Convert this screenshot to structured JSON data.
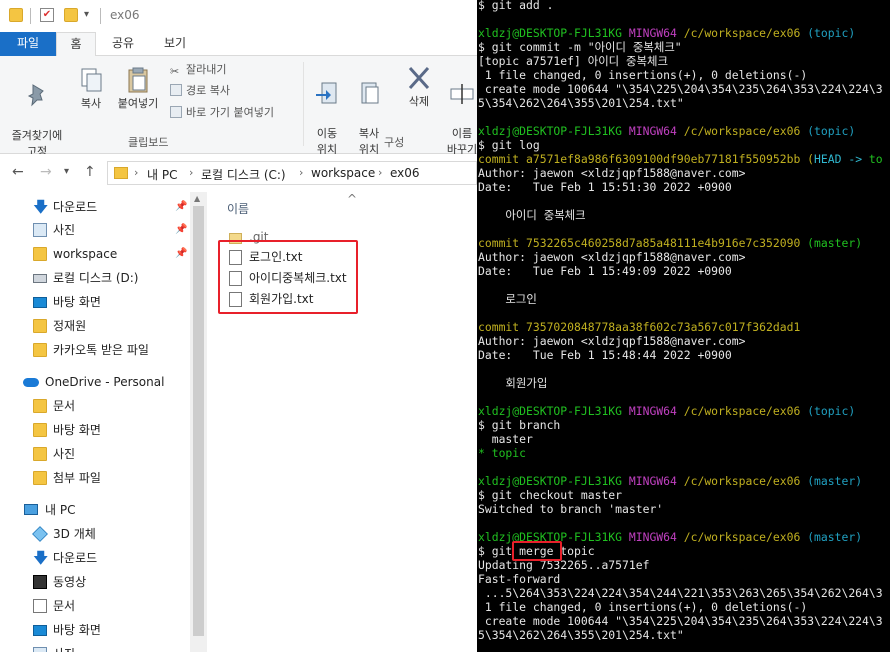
{
  "window": {
    "title": "ex06"
  },
  "ribbon": {
    "tabs": [
      "파일",
      "홈",
      "공유",
      "보기"
    ],
    "clipboard": {
      "pin_quick": "즐겨찾기에\n고정",
      "copy": "복사",
      "paste": "붙여넣기",
      "cut": "잘라내기",
      "copy_path": "경로 복사",
      "paste_shortcut": "바로 가기 붙여넣기",
      "group_label": "클립보드"
    },
    "organize": {
      "move_to": "이동\n위치",
      "copy_to": "복사\n위치",
      "delete": "삭제",
      "rename": "이름\n바꾸기",
      "group_label": "구성"
    }
  },
  "address": {
    "crumbs": [
      "내 PC",
      "로컬 디스크 (C:)",
      "workspace",
      "ex06"
    ]
  },
  "nav": {
    "items": [
      {
        "label": "다운로드",
        "icon": "download-icon",
        "pinned": true
      },
      {
        "label": "사진",
        "icon": "pictures-icon",
        "pinned": true
      },
      {
        "label": "workspace",
        "icon": "folder-icon",
        "pinned": true
      },
      {
        "label": "로컬 디스크 (D:)",
        "icon": "drive-icon",
        "pinned": false
      },
      {
        "label": "바탕 화면",
        "icon": "desktop-icon",
        "pinned": false
      },
      {
        "label": "정재원",
        "icon": "folder-icon",
        "pinned": false
      },
      {
        "label": "카카오톡 받은 파일",
        "icon": "folder-icon",
        "pinned": false
      },
      {
        "label": "OneDrive - Personal",
        "icon": "onedrive-icon",
        "pinned": false
      },
      {
        "label": "문서",
        "icon": "folder-icon",
        "pinned": false
      },
      {
        "label": "바탕 화면",
        "icon": "folder-icon",
        "pinned": false
      },
      {
        "label": "사진",
        "icon": "folder-icon",
        "pinned": false
      },
      {
        "label": "첨부 파일",
        "icon": "folder-icon",
        "pinned": false
      },
      {
        "label": "내 PC",
        "icon": "pc-icon",
        "pinned": false
      },
      {
        "label": "3D 개체",
        "icon": "3d-objects-icon",
        "pinned": false
      },
      {
        "label": "다운로드",
        "icon": "download-icon",
        "pinned": false
      },
      {
        "label": "동영상",
        "icon": "videos-icon",
        "pinned": false
      },
      {
        "label": "문서",
        "icon": "documents-icon",
        "pinned": false
      },
      {
        "label": "바탕 화면",
        "icon": "desktop-icon",
        "pinned": false
      },
      {
        "label": "사진",
        "icon": "pictures-icon",
        "pinned": false
      }
    ]
  },
  "files": {
    "column_name": "이름",
    "items": [
      {
        "name": ".git",
        "type": "folder"
      },
      {
        "name": "로그인.txt",
        "type": "text"
      },
      {
        "name": "아이디중복체크.txt",
        "type": "text"
      },
      {
        "name": "회원가입.txt",
        "type": "text"
      }
    ]
  },
  "terminal": {
    "lines": [
      "$ git add .",
      "",
      "xldzj@DESKTOP-FJL31KG MINGW64 /c/workspace/ex06 (topic)",
      "$ git commit -m \"아이디 중복체크\"",
      "[topic a7571ef] 아이디 중복체크",
      " 1 file changed, 0 insertions(+), 0 deletions(-)",
      " create mode 100644 \"\\354\\225\\204\\354\\235\\264\\353\\224\\224\\3",
      "5\\354\\262\\264\\355\\201\\254.txt\"",
      "",
      "xldzj@DESKTOP-FJL31KG MINGW64 /c/workspace/ex06 (topic)",
      "$ git log",
      "commit a7571ef8a986f6309100df90eb77181f550952bb (HEAD -> to",
      "Author: jaewon <xldzjqpf1588@naver.com>",
      "Date:   Tue Feb 1 15:51:30 2022 +0900",
      "",
      "    아이디 중복체크",
      "",
      "commit 7532265c460258d7a85a48111e4b916e7c352090 (master)",
      "Author: jaewon <xldzjqpf1588@naver.com>",
      "Date:   Tue Feb 1 15:49:09 2022 +0900",
      "",
      "    로그인",
      "",
      "commit 7357020848778aa38f602c73a567c017f362dad1",
      "Author: jaewon <xldzjqpf1588@naver.com>",
      "Date:   Tue Feb 1 15:48:44 2022 +0900",
      "",
      "    회원가입",
      "",
      "xldzj@DESKTOP-FJL31KG MINGW64 /c/workspace/ex06 (topic)",
      "$ git branch",
      "  master",
      "* topic",
      "",
      "xldzj@DESKTOP-FJL31KG MINGW64 /c/workspace/ex06 (master)",
      "$ git checkout master",
      "Switched to branch 'master'",
      "",
      "xldzj@DESKTOP-FJL31KG MINGW64 /c/workspace/ex06 (master)",
      "$ git merge topic",
      "Updating 7532265..a7571ef",
      "Fast-forward",
      " ...5\\264\\353\\224\\224\\354\\244\\221\\353\\263\\265\\354\\262\\264\\3",
      " 1 file changed, 0 insertions(+), 0 deletions(-)",
      " create mode 100644 \"\\354\\225\\204\\354\\235\\264\\353\\224\\224\\3",
      "5\\354\\262\\264\\355\\201\\254.txt\""
    ]
  }
}
